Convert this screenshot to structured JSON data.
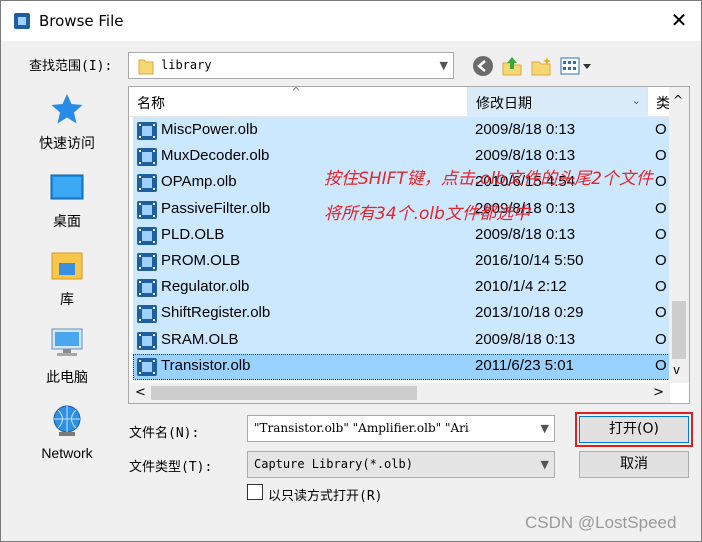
{
  "window": {
    "title": "Browse File",
    "close": "✕"
  },
  "lookin": {
    "label": "查找范围(I):",
    "value": "library"
  },
  "places": [
    {
      "label": "快速访问",
      "icon": "star-icon"
    },
    {
      "label": "桌面",
      "icon": "desktop-icon"
    },
    {
      "label": "库",
      "icon": "library-icon"
    },
    {
      "label": "此电脑",
      "icon": "computer-icon"
    },
    {
      "label": "Network",
      "icon": "network-icon"
    }
  ],
  "columns": {
    "name": "名称",
    "date": "修改日期",
    "type": "类"
  },
  "files": [
    {
      "name": "MiscPower.olb",
      "date": "2009/8/18 0:13",
      "type": "O"
    },
    {
      "name": "MuxDecoder.olb",
      "date": "2009/8/18 0:13",
      "type": "O"
    },
    {
      "name": "OPAmp.olb",
      "date": "2010/6/15 4:54",
      "type": "O"
    },
    {
      "name": "PassiveFilter.olb",
      "date": "2009/8/18 0:13",
      "type": "O"
    },
    {
      "name": "PLD.OLB",
      "date": "2009/8/18 0:13",
      "type": "O"
    },
    {
      "name": "PROM.OLB",
      "date": "2016/10/14 5:50",
      "type": "O"
    },
    {
      "name": "Regulator.olb",
      "date": "2010/1/4 2:12",
      "type": "O"
    },
    {
      "name": "ShiftRegister.olb",
      "date": "2013/10/18 0:29",
      "type": "O"
    },
    {
      "name": "SRAM.OLB",
      "date": "2009/8/18 0:13",
      "type": "O"
    },
    {
      "name": "Transistor.olb",
      "date": "2011/6/23 5:01",
      "type": "O"
    }
  ],
  "annotations": {
    "line1": "按住SHIFT键，点击.olb文件的头尾2个文件",
    "line2": "将所有34个.olb文件都选中",
    "color": "#e8232a"
  },
  "filename": {
    "label": "文件名(N):",
    "value": "\"Transistor.olb\" \"Amplifier.olb\" \"Ari"
  },
  "filetype": {
    "label": "文件类型(T):",
    "value": "Capture Library(*.olb)"
  },
  "buttons": {
    "open": "打开(O)",
    "cancel": "取消"
  },
  "readonly": {
    "label": "以只读方式打开(R)",
    "checked": false
  },
  "watermark": "CSDN @LostSpeed",
  "colors": {
    "selection": "#cce8ff",
    "focus_row": "#99d1ff",
    "accent": "#0078d7"
  }
}
